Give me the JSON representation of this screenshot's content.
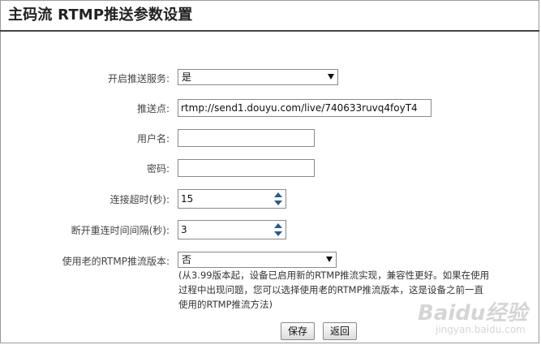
{
  "page": {
    "title": "主码流 RTMP推送参数设置"
  },
  "form": {
    "enable_push": {
      "label": "开启推送服务:",
      "value": "是"
    },
    "push_url": {
      "label": "推送点:",
      "value": "rtmp://send1.douyu.com/live/740633ruvq4foyT4"
    },
    "username": {
      "label": "用户名:",
      "value": ""
    },
    "password": {
      "label": "密码:",
      "value": ""
    },
    "timeout": {
      "label": "连接超时(秒):",
      "value": "15"
    },
    "reconnect": {
      "label": "断开重连时间间隔(秒):",
      "value": "3"
    },
    "legacy_rtmp": {
      "label": "使用老的RTMP推流版本:",
      "value": "否"
    },
    "note_lines": [
      "(从3.99版本起，设备已启用新的RTMP推流实现，兼容性更好。如果在使用",
      "过程中出现问题，您可以选择使用老的RTMP推流版本，这是设备之前一直",
      "使用的RTMP推流方法)"
    ]
  },
  "buttons": {
    "save": "保存",
    "back": "返回"
  },
  "watermark": {
    "brand": "Baidu经验",
    "domain": "jingyan.baidu.com"
  }
}
